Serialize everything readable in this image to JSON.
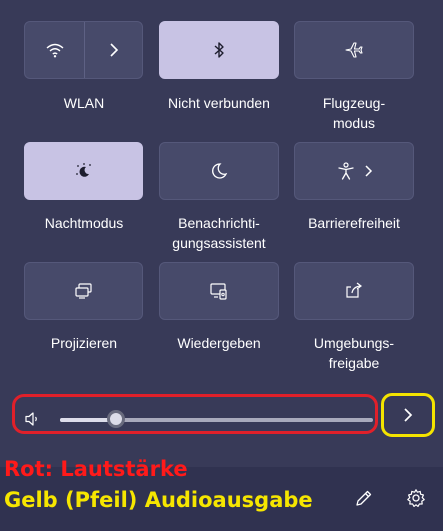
{
  "quick_settings": {
    "tiles": [
      {
        "label": "WLAN",
        "icon": "wifi-icon",
        "active": false,
        "has_chevron": true
      },
      {
        "label": "Nicht verbunden",
        "icon": "bluetooth-icon",
        "active": true
      },
      {
        "label": "Flugzeug-\nmodus",
        "icon": "airplane-icon",
        "active": false
      },
      {
        "label": "Nachtmodus",
        "icon": "night-light-icon",
        "active": true
      },
      {
        "label": "Benachrichti-\ngungsassistent",
        "icon": "focus-assist-moon-icon",
        "active": false
      },
      {
        "label": "Barrierefreiheit",
        "icon": "accessibility-icon",
        "active": false,
        "has_chevron": true
      },
      {
        "label": "Projizieren",
        "icon": "project-icon",
        "active": false
      },
      {
        "label": "Wiedergeben",
        "icon": "cast-icon",
        "active": false
      },
      {
        "label": "Umgebungs-\nfreigabe",
        "icon": "nearby-share-icon",
        "active": false
      }
    ]
  },
  "volume": {
    "icon": "speaker-icon",
    "level": 0.18,
    "output_arrow_icon": "chevron-right-icon"
  },
  "annotations": {
    "red": "Rot: Lautstärke",
    "yellow": "Gelb (Pfeil) Audioausgabe"
  },
  "footer": {
    "edit_icon": "pencil-icon",
    "settings_icon": "gear-icon"
  },
  "colors": {
    "panel_bg": "#383a58",
    "tile_bg": "#474a6a",
    "tile_active_bg": "#c8c3e4",
    "annotation_red": "#ff1a1a",
    "annotation_yellow": "#f6e600"
  }
}
